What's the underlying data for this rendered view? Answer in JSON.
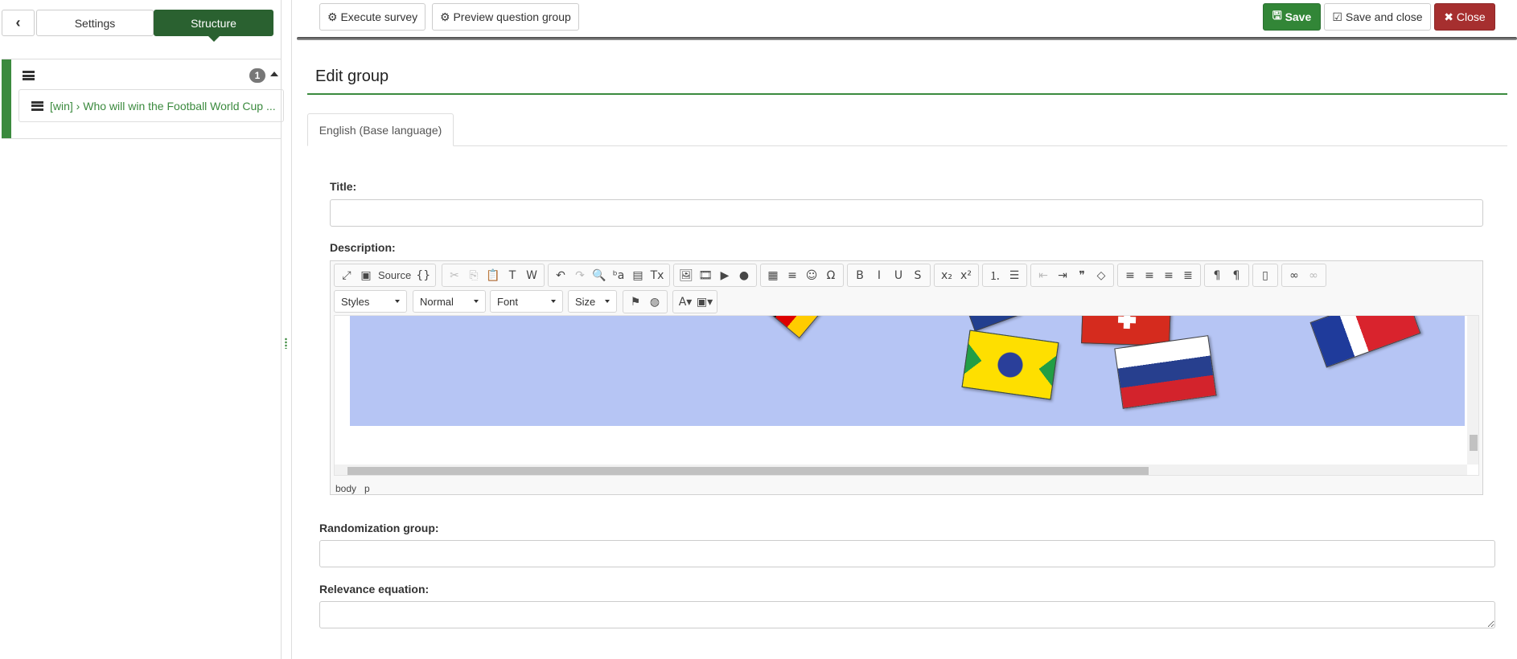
{
  "sidebar": {
    "back_icon": "chevron-left-icon",
    "tabs": [
      "Settings",
      "Structure"
    ],
    "group_count": "1",
    "question_item": "[win] › Who will win the Football World Cup ..."
  },
  "topbar": {
    "execute": "Execute survey",
    "preview": "Preview question group",
    "save": "Save",
    "save_close": "Save and close",
    "close": "Close"
  },
  "colors": {
    "accent": "#328637",
    "danger": "#a62f2f",
    "structure_tab": "#2a6130"
  },
  "form": {
    "heading": "Edit group",
    "language_tab": "English (Base language)",
    "title_label": "Title:",
    "title_value": "",
    "description_label": "Description:",
    "randomization_label": "Randomization group:",
    "randomization_value": "",
    "relevance_label": "Relevance equation:",
    "relevance_value": ""
  },
  "editor": {
    "source_label": "Source",
    "combos": [
      "Styles",
      "Normal",
      "Font",
      "Size"
    ],
    "status_path": [
      "body",
      "p"
    ],
    "groups": [
      [
        {
          "n": "maximize-icon",
          "g": "⤢"
        },
        {
          "n": "source-icon",
          "g": "▣",
          "t": "Source"
        },
        {
          "n": "template-icon",
          "g": "{}"
        }
      ],
      [
        {
          "n": "cut-icon",
          "g": "✂",
          "d": 1
        },
        {
          "n": "copy-icon",
          "g": "⎘",
          "d": 1
        },
        {
          "n": "paste-icon",
          "g": "📋",
          "d": 0
        },
        {
          "n": "paste-text-icon",
          "g": "T"
        },
        {
          "n": "paste-word-icon",
          "g": "W"
        }
      ],
      [
        {
          "n": "undo-icon",
          "g": "↶"
        },
        {
          "n": "redo-icon",
          "g": "↷",
          "d": 1
        },
        {
          "n": "find-icon",
          "g": "🔍"
        },
        {
          "n": "replace-icon",
          "g": "ᵇa"
        },
        {
          "n": "select-all-icon",
          "g": "▤"
        },
        {
          "n": "remove-format-icon",
          "g": "Tx"
        }
      ],
      [
        {
          "n": "image-icon",
          "g": "🖼"
        },
        {
          "n": "video-icon",
          "g": "🎞"
        },
        {
          "n": "media-icon",
          "g": "▶"
        },
        {
          "n": "flash-icon",
          "g": "●"
        }
      ],
      [
        {
          "n": "table-icon",
          "g": "▦"
        },
        {
          "n": "horizontal-rule-icon",
          "g": "≡"
        },
        {
          "n": "smiley-icon",
          "g": "☺"
        },
        {
          "n": "special-char-icon",
          "g": "Ω"
        }
      ],
      [
        {
          "n": "bold-icon",
          "g": "B"
        },
        {
          "n": "italic-icon",
          "g": "I"
        },
        {
          "n": "underline-icon",
          "g": "U"
        },
        {
          "n": "strike-icon",
          "g": "S"
        }
      ],
      [
        {
          "n": "subscript-icon",
          "g": "x₂"
        },
        {
          "n": "superscript-icon",
          "g": "x²"
        }
      ],
      [
        {
          "n": "numbered-list-icon",
          "g": "⒈"
        },
        {
          "n": "bulleted-list-icon",
          "g": "☰"
        }
      ],
      [
        {
          "n": "outdent-icon",
          "g": "⇤",
          "d": 1
        },
        {
          "n": "indent-icon",
          "g": "⇥"
        },
        {
          "n": "blockquote-icon",
          "g": "❞"
        },
        {
          "n": "div-icon",
          "g": "◇"
        }
      ],
      [
        {
          "n": "align-left-icon",
          "g": "≡"
        },
        {
          "n": "align-center-icon",
          "g": "≡"
        },
        {
          "n": "align-right-icon",
          "g": "≡"
        },
        {
          "n": "justify-icon",
          "g": "≣"
        }
      ],
      [
        {
          "n": "ltr-icon",
          "g": "¶"
        },
        {
          "n": "rtl-icon",
          "g": "¶"
        }
      ],
      [
        {
          "n": "page-break-icon",
          "g": "▯"
        }
      ],
      [
        {
          "n": "link-icon",
          "g": "∞"
        },
        {
          "n": "unlink-icon",
          "g": "∞",
          "d": 1
        }
      ]
    ],
    "row2_groups": [
      [
        {
          "n": "anchor-flag-icon",
          "g": "⚑"
        },
        {
          "n": "language-globe-icon",
          "g": "◍"
        }
      ],
      [
        {
          "n": "text-color-icon",
          "g": "A▾"
        },
        {
          "n": "bg-color-icon",
          "g": "▣▾"
        }
      ]
    ]
  }
}
